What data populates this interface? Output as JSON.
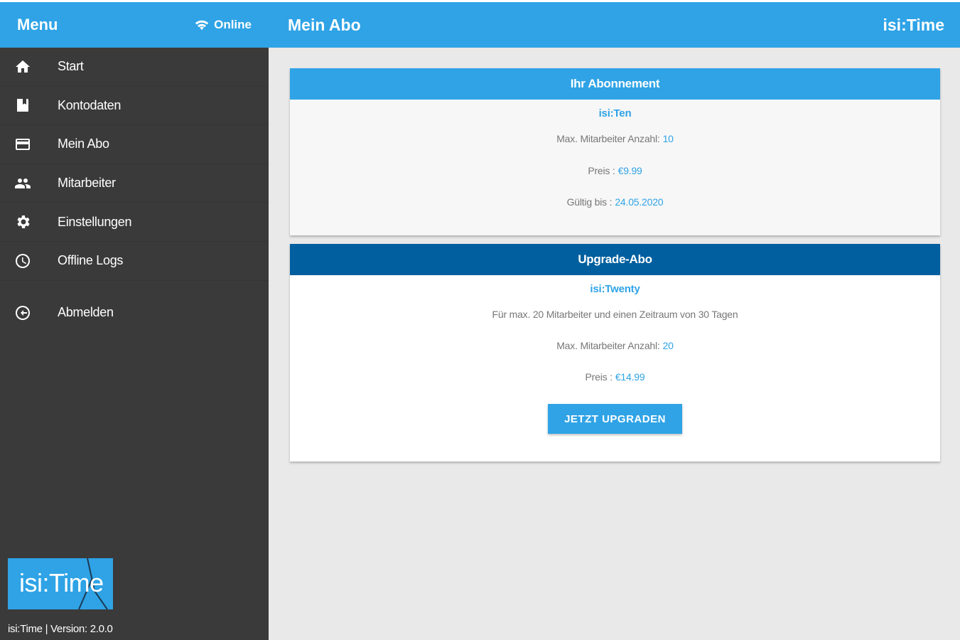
{
  "sidebar": {
    "title": "Menu",
    "status": "Online",
    "items": [
      {
        "label": "Start",
        "icon": "home-icon"
      },
      {
        "label": "Kontodaten",
        "icon": "book-icon"
      },
      {
        "label": "Mein Abo",
        "icon": "credit-card-icon"
      },
      {
        "label": "Mitarbeiter",
        "icon": "people-icon"
      },
      {
        "label": "Einstellungen",
        "icon": "gear-icon"
      },
      {
        "label": "Offline Logs",
        "icon": "clock-icon"
      }
    ],
    "logout": {
      "label": "Abmelden",
      "icon": "logout-icon"
    },
    "logo_text": "isi:Time",
    "version": "isi:Time | Version: 2.0.0"
  },
  "header": {
    "title": "Mein Abo",
    "brand": "isi:Time"
  },
  "subscription": {
    "heading": "Ihr Abonnement",
    "plan": "isi:Ten",
    "max_label": "Max. Mitarbeiter Anzahl:",
    "max_value": "10",
    "price_label": "Preis :",
    "price_value": "€9.99",
    "valid_label": "Gültig bis :",
    "valid_value": "24.05.2020"
  },
  "upgrade": {
    "heading": "Upgrade-Abo",
    "plan": "isi:Twenty",
    "description": "Für max. 20 Mitarbeiter und einen Zeitraum von 30 Tagen",
    "max_label": "Max. Mitarbeiter Anzahl:",
    "max_value": "20",
    "price_label": "Preis :",
    "price_value": "€14.99",
    "button_label": "JETZT UPGRADEN"
  },
  "colors": {
    "primary": "#2fa3e6",
    "dark_primary": "#015f9f",
    "sidebar_bg": "#3a3a3a",
    "background": "#e9e9e9"
  }
}
